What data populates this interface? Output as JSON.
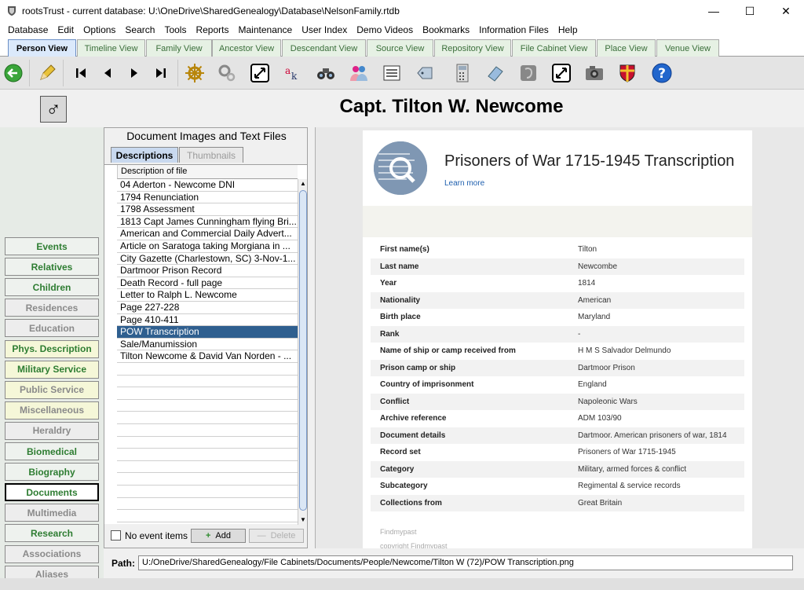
{
  "window": {
    "title": "rootsTrust - current database: U:\\OneDrive\\SharedGenealogy\\Database\\NelsonFamily.rtdb"
  },
  "menu": [
    "Database",
    "Edit",
    "Options",
    "Search",
    "Tools",
    "Reports",
    "Maintenance",
    "User Index",
    "Demo Videos",
    "Bookmarks",
    "Information Files",
    "Help"
  ],
  "tabs": [
    "Person View",
    "Timeline View",
    "Family View",
    "Ancestor View",
    "Descendant View",
    "Source View",
    "Repository View",
    "File Cabinet View",
    "Place View",
    "Venue View"
  ],
  "toolbar_icons": [
    "back-arrow-icon",
    "pencil-icon",
    "first-record-icon",
    "previous-record-icon",
    "next-record-icon",
    "last-record-icon",
    "ship-wheel-icon",
    "gears-icon",
    "expand-icon",
    "spellcheck-icon",
    "binoculars-icon",
    "people-icon",
    "list-icon",
    "tag-icon",
    "calculator-icon",
    "eraser-icon",
    "evernote-icon",
    "fullscreen-icon",
    "camera-icon",
    "coat-of-arms-icon",
    "help-icon"
  ],
  "person": {
    "gender_symbol": "♂",
    "name": "Capt. Tilton W. Newcome"
  },
  "sidebar": [
    {
      "label": "Events",
      "style": "green"
    },
    {
      "label": "Relatives",
      "style": "green"
    },
    {
      "label": "Children",
      "style": "green"
    },
    {
      "label": "Residences",
      "style": "grey"
    },
    {
      "label": "Education",
      "style": "grey"
    },
    {
      "label": "Phys. Description",
      "style": "yellow"
    },
    {
      "label": "Military Service",
      "style": "yellow"
    },
    {
      "label": "Public Service",
      "style": "grey-yellow"
    },
    {
      "label": "Miscellaneous",
      "style": "grey-yellow"
    },
    {
      "label": "Heraldry",
      "style": "grey"
    },
    {
      "label": "Biomedical",
      "style": "green"
    },
    {
      "label": "Biography",
      "style": "green"
    },
    {
      "label": "Documents",
      "style": "active"
    },
    {
      "label": "Multimedia",
      "style": "grey"
    },
    {
      "label": "Research",
      "style": "green"
    },
    {
      "label": "Associations",
      "style": "grey"
    },
    {
      "label": "Aliases",
      "style": "grey"
    }
  ],
  "documents": {
    "title": "Document Images and Text Files",
    "tab_descriptions": "Descriptions",
    "tab_thumbnails": "Thumbnails",
    "column_header": "Description of file",
    "files": [
      "04 Aderton - Newcome  DNI",
      "1794 Renunciation",
      "1798 Assessment",
      "1813 Capt James Cunningham flying Bri...",
      "American and Commercial Daily Advert...",
      "Article on Saratoga taking Morgiana in ...",
      "City Gazette (Charlestown, SC) 3-Nov-1...",
      "Dartmoor Prison Record",
      "Death Record - full page",
      "Letter to Ralph L. Newcome",
      "Page 227-228",
      "Page 410-411",
      "POW Transcription",
      "Sale/Manumission",
      "Tilton Newcome & David Van Norden - ..."
    ],
    "selected_index": 12,
    "no_event_items_label": "No event items",
    "add_label": "Add",
    "delete_label": "Delete"
  },
  "record": {
    "title": "Prisoners of War 1715-1945 Transcription",
    "learn_more": "Learn more",
    "fields": [
      {
        "key": "First name(s)",
        "value": "Tilton"
      },
      {
        "key": "Last name",
        "value": "Newcombe"
      },
      {
        "key": "Year",
        "value": "1814"
      },
      {
        "key": "Nationality",
        "value": "American"
      },
      {
        "key": "Birth place",
        "value": "Maryland"
      },
      {
        "key": "Rank",
        "value": "-"
      },
      {
        "key": "Name of ship or camp received from",
        "value": "H M S Salvador Delmundo"
      },
      {
        "key": "Prison camp or ship",
        "value": "Dartmoor Prison"
      },
      {
        "key": "Country of imprisonment",
        "value": "England"
      },
      {
        "key": "Conflict",
        "value": "Napoleonic Wars"
      },
      {
        "key": "Archive reference",
        "value": "ADM 103/90"
      },
      {
        "key": "Document details",
        "value": "Dartmoor. American prisoners of war, 1814"
      },
      {
        "key": "Record set",
        "value": "Prisoners of War 1715-1945"
      },
      {
        "key": "Category",
        "value": "Military, armed forces & conflict"
      },
      {
        "key": "Subcategory",
        "value": "Regimental & service records"
      },
      {
        "key": "Collections from",
        "value": "Great Britain"
      }
    ],
    "footer_source": "Findmypast",
    "footer_copyright": "copyright Findmypast"
  },
  "path": {
    "label": "Path:",
    "value": "U:/OneDrive/SharedGenealogy/File Cabinets/Documents/People/Newcome/Tilton W (72)/POW Transcription.png"
  }
}
